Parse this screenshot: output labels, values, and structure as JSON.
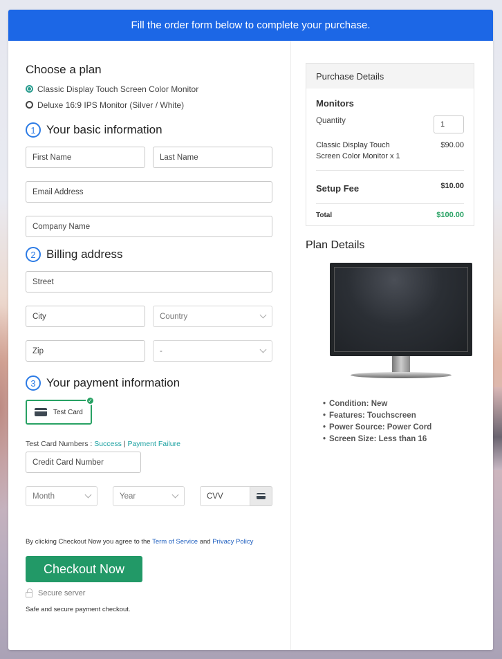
{
  "banner": {
    "text": "Fill the order form below to complete your purchase."
  },
  "plan": {
    "title": "Choose a plan",
    "options": [
      {
        "label": "Classic Display Touch Screen Color Monitor",
        "selected": true
      },
      {
        "label": "Deluxe 16:9 IPS Monitor (Silver / White)",
        "selected": false
      }
    ]
  },
  "basic_info": {
    "step": "1",
    "title": "Your basic information",
    "first_name_placeholder": "First Name",
    "last_name_placeholder": "Last Name",
    "email_placeholder": "Email Address",
    "company_placeholder": "Company Name"
  },
  "billing": {
    "step": "2",
    "title": "Billing address",
    "street_placeholder": "Street",
    "city_placeholder": "City",
    "country_selected": "Country",
    "zip_placeholder": "Zip",
    "state_selected": "-"
  },
  "payment": {
    "step": "3",
    "title": "Your payment information",
    "method_label": "Test Card",
    "test_numbers_label": "Test Card Numbers :",
    "success_link": "Success",
    "separator": "|",
    "failure_link": "Payment Failure",
    "card_number_placeholder": "Credit Card Number",
    "month_selected": "Month",
    "year_selected": "Year",
    "cvv_placeholder": "CVV",
    "terms_prefix": "By clicking Checkout Now you agree to the",
    "terms_link": "Term of Service",
    "terms_and": "and",
    "privacy_link": "Privacy Policy",
    "checkout_label": "Checkout Now",
    "secure_label": "Secure server",
    "safe_text": "Safe and secure payment checkout."
  },
  "purchase": {
    "title": "Purchase Details",
    "category": "Monitors",
    "quantity_label": "Quantity",
    "quantity_value": "1",
    "item_name": "Classic Display Touch Screen Color Monitor x 1",
    "item_price": "$90.00",
    "setup_fee_label": "Setup Fee",
    "setup_fee_value": "$10.00",
    "total_label": "Total",
    "total_value": "$100.00"
  },
  "plan_details": {
    "title": "Plan Details",
    "image_alt": "monitor-image",
    "features": [
      "Condition: New",
      "Features: Touchscreen",
      "Power Source: Power Cord",
      "Screen Size: Less than 16"
    ]
  },
  "colors": {
    "banner": "#1c67e6",
    "accent_green": "#229967",
    "total_green": "#27a163",
    "step_blue": "#2c7be5",
    "link_teal": "#1ba1a1"
  }
}
